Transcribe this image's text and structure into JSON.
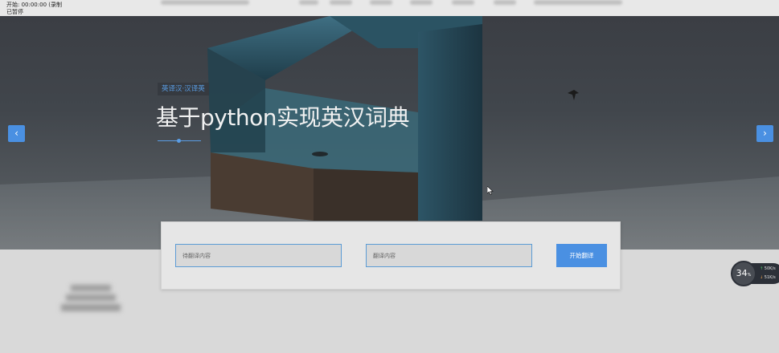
{
  "overlay": {
    "line1": "开始: 00:00:00 (录制",
    "line2": "已暂停"
  },
  "hero": {
    "tag": "英译汉·汉译英",
    "title": "基于python实现英汉词典",
    "prev_label": "‹",
    "next_label": "›"
  },
  "translator": {
    "source_placeholder": "待翻译内容",
    "target_placeholder": "翻译内容",
    "start_button": "开始翻译"
  },
  "speed_widget": {
    "percent": "34",
    "percent_unit": "%",
    "upload": "50K/s",
    "download": "51K/s"
  },
  "colors": {
    "accent": "#4a90e2",
    "tag_text": "#5a9ee6"
  }
}
